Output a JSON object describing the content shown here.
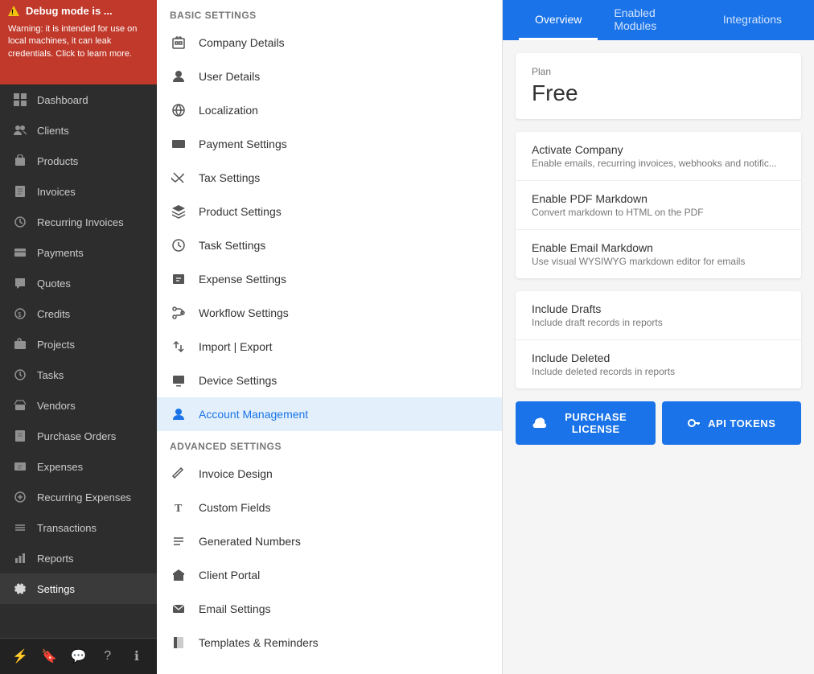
{
  "debug": {
    "title": "Debug mode is ...",
    "body": "Warning: it is intended for use on local machines, it can leak credentials. Click to learn more."
  },
  "sidebar": {
    "items": [
      {
        "id": "dashboard",
        "label": "Dashboard",
        "icon": "grid"
      },
      {
        "id": "clients",
        "label": "Clients",
        "icon": "people"
      },
      {
        "id": "products",
        "label": "Products",
        "icon": "box"
      },
      {
        "id": "invoices",
        "label": "Invoices",
        "icon": "document"
      },
      {
        "id": "recurring-invoices",
        "label": "Recurring Invoices",
        "icon": "recurring"
      },
      {
        "id": "payments",
        "label": "Payments",
        "icon": "payment"
      },
      {
        "id": "quotes",
        "label": "Quotes",
        "icon": "quote"
      },
      {
        "id": "credits",
        "label": "Credits",
        "icon": "credit"
      },
      {
        "id": "projects",
        "label": "Projects",
        "icon": "briefcase"
      },
      {
        "id": "tasks",
        "label": "Tasks",
        "icon": "clock"
      },
      {
        "id": "vendors",
        "label": "Vendors",
        "icon": "vendor"
      },
      {
        "id": "purchase-orders",
        "label": "Purchase Orders",
        "icon": "purchase"
      },
      {
        "id": "expenses",
        "label": "Expenses",
        "icon": "expenses"
      },
      {
        "id": "recurring-expenses",
        "label": "Recurring Expenses",
        "icon": "recurring-exp"
      },
      {
        "id": "transactions",
        "label": "Transactions",
        "icon": "transactions"
      },
      {
        "id": "reports",
        "label": "Reports",
        "icon": "reports"
      },
      {
        "id": "settings",
        "label": "Settings",
        "icon": "settings",
        "active": true
      }
    ],
    "footer": {
      "icons": [
        "lightning",
        "bookmark",
        "chat",
        "help",
        "info"
      ]
    }
  },
  "settings_panel": {
    "basic_settings_label": "Basic Settings",
    "advanced_settings_label": "Advanced Settings",
    "basic_items": [
      {
        "id": "company-details",
        "label": "Company Details",
        "icon": "building"
      },
      {
        "id": "user-details",
        "label": "User Details",
        "icon": "user"
      },
      {
        "id": "localization",
        "label": "Localization",
        "icon": "globe"
      },
      {
        "id": "payment-settings",
        "label": "Payment Settings",
        "icon": "credit-card"
      },
      {
        "id": "tax-settings",
        "label": "Tax Settings",
        "icon": "scissors"
      },
      {
        "id": "product-settings",
        "label": "Product Settings",
        "icon": "cube"
      },
      {
        "id": "task-settings",
        "label": "Task Settings",
        "icon": "clock2"
      },
      {
        "id": "expense-settings",
        "label": "Expense Settings",
        "icon": "expense"
      },
      {
        "id": "workflow-settings",
        "label": "Workflow Settings",
        "icon": "workflow"
      },
      {
        "id": "import-export",
        "label": "Import | Export",
        "icon": "import"
      },
      {
        "id": "device-settings",
        "label": "Device Settings",
        "icon": "device"
      },
      {
        "id": "account-management",
        "label": "Account Management",
        "icon": "account",
        "active": true
      }
    ],
    "advanced_items": [
      {
        "id": "invoice-design",
        "label": "Invoice Design",
        "icon": "design"
      },
      {
        "id": "custom-fields",
        "label": "Custom Fields",
        "icon": "text-field"
      },
      {
        "id": "generated-numbers",
        "label": "Generated Numbers",
        "icon": "list"
      },
      {
        "id": "client-portal",
        "label": "Client Portal",
        "icon": "cloud"
      },
      {
        "id": "email-settings",
        "label": "Email Settings",
        "icon": "email"
      },
      {
        "id": "templates-reminders",
        "label": "Templates & Reminders",
        "icon": "template"
      }
    ]
  },
  "main": {
    "tabs": [
      {
        "id": "overview",
        "label": "Overview",
        "active": true
      },
      {
        "id": "enabled-modules",
        "label": "Enabled Modules"
      },
      {
        "id": "integrations",
        "label": "Integrations"
      }
    ],
    "plan": {
      "label": "Plan",
      "name": "Free"
    },
    "activate_section": {
      "rows": [
        {
          "title": "Activate Company",
          "desc": "Enable emails, recurring invoices, webhooks and notific..."
        },
        {
          "title": "Enable PDF Markdown",
          "desc": "Convert markdown to HTML on the PDF"
        },
        {
          "title": "Enable Email Markdown",
          "desc": "Use visual WYSIWYG markdown editor for emails"
        }
      ]
    },
    "reports_section": {
      "rows": [
        {
          "title": "Include Drafts",
          "desc": "Include draft records in reports"
        },
        {
          "title": "Include Deleted",
          "desc": "Include deleted records in reports"
        }
      ]
    },
    "buttons": [
      {
        "id": "purchase-license",
        "label": "PURCHASE LICENSE",
        "icon": "cloud-upload"
      },
      {
        "id": "api-tokens",
        "label": "API TOKENS",
        "icon": "key"
      }
    ]
  }
}
